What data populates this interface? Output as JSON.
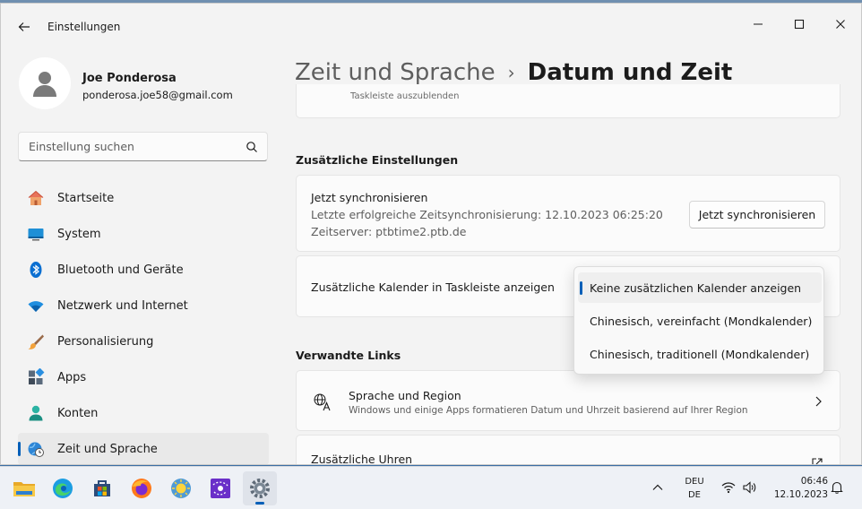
{
  "window": {
    "title": "Einstellungen"
  },
  "user": {
    "name": "Joe Ponderosa",
    "email": "ponderosa.joe58@gmail.com"
  },
  "search": {
    "placeholder": "Einstellung suchen"
  },
  "nav": {
    "items": [
      {
        "label": "Startseite",
        "icon": "home-icon"
      },
      {
        "label": "System",
        "icon": "system-icon"
      },
      {
        "label": "Bluetooth und Geräte",
        "icon": "bluetooth-icon"
      },
      {
        "label": "Netzwerk und Internet",
        "icon": "wifi-icon"
      },
      {
        "label": "Personalisierung",
        "icon": "brush-icon"
      },
      {
        "label": "Apps",
        "icon": "apps-icon"
      },
      {
        "label": "Konten",
        "icon": "account-icon"
      },
      {
        "label": "Zeit und Sprache",
        "icon": "globe-clock-icon",
        "active": true
      }
    ]
  },
  "breadcrumb": {
    "parent": "Zeit und Sprache",
    "separator": "›",
    "current": "Datum und Zeit"
  },
  "prev_card": {
    "text": "Taskleiste auszublenden"
  },
  "additional": {
    "title": "Zusätzliche Einstellungen",
    "sync": {
      "title": "Jetzt synchronisieren",
      "last_sync": "Letzte erfolgreiche Zeitsynchronisierung: 12.10.2023 06:25:20",
      "server": "Zeitserver: ptbtime2.ptb.de",
      "button": "Jetzt synchronisieren"
    },
    "calendar": {
      "label": "Zusätzliche Kalender in Taskleiste anzeigen",
      "options": [
        "Keine zusätzlichen Kalender anzeigen",
        "Chinesisch, vereinfacht (Mondkalender)",
        "Chinesisch, traditionell (Mondkalender)"
      ],
      "selected": "Keine zusätzlichen Kalender anzeigen"
    }
  },
  "related": {
    "title": "Verwandte Links",
    "language": {
      "title": "Sprache und Region",
      "description": "Windows und einige Apps formatieren Datum und Uhrzeit basierend auf Ihrer Region"
    },
    "clocks": {
      "title": "Zusätzliche Uhren"
    }
  },
  "taskbar": {
    "apps": [
      "file-explorer-icon",
      "edge-icon",
      "store-icon",
      "firefox-icon",
      "weather-icon",
      "paint-icon",
      "settings-icon"
    ],
    "lang_line1": "DEU",
    "lang_line2": "DE",
    "time": "06:46",
    "date": "12.10.2023"
  },
  "colors": {
    "accent": "#005fb8",
    "window_bg": "#f3f3f3",
    "card_bg": "#fbfbfb",
    "taskbar_bg": "#eef1f6"
  }
}
